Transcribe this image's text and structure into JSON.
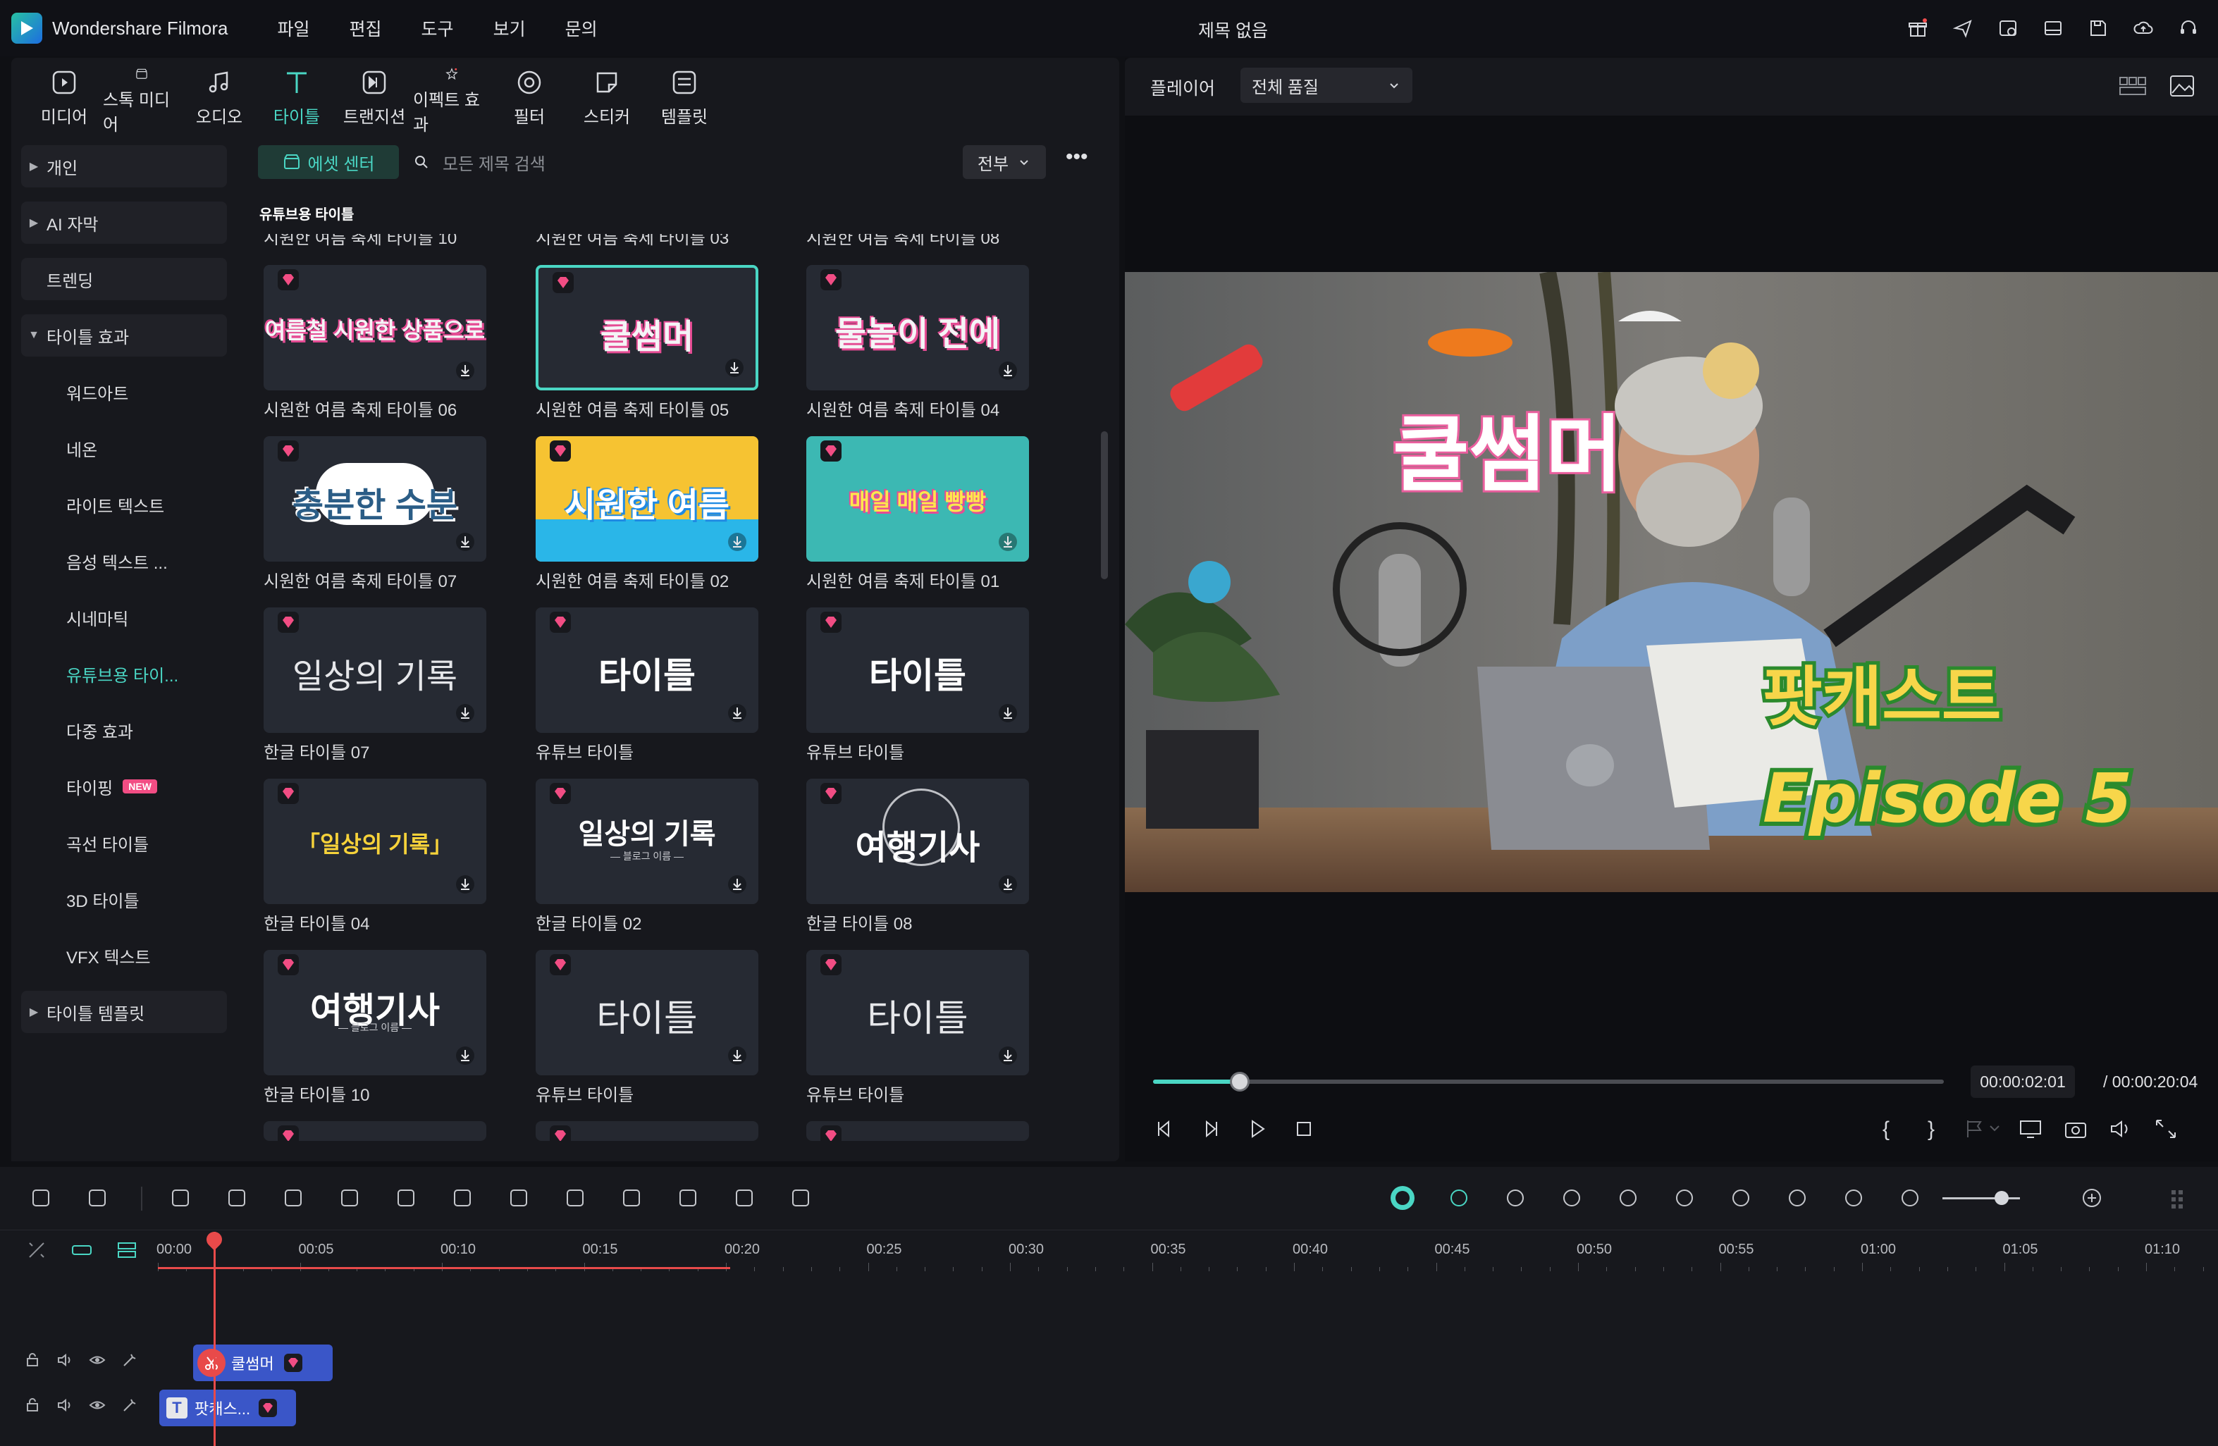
{
  "app": {
    "name": "Wondershare Filmora",
    "document_title": "제목 없음",
    "accent": "#4ad6c4"
  },
  "menu": [
    "파일",
    "편집",
    "도구",
    "보기",
    "문의"
  ],
  "titlebar_icons": [
    "gift-icon",
    "send-icon",
    "task-icon",
    "layout-icon",
    "save-icon",
    "cloud-icon",
    "support-icon"
  ],
  "toolbar": [
    {
      "label": "미디어",
      "icon": "media-icon"
    },
    {
      "label": "스톡 미디어",
      "icon": "stock-icon"
    },
    {
      "label": "오디오",
      "icon": "audio-icon"
    },
    {
      "label": "타이틀",
      "icon": "title-icon",
      "active": true
    },
    {
      "label": "트랜지션",
      "icon": "transition-icon"
    },
    {
      "label": "이펙트 효과",
      "icon": "effect-icon"
    },
    {
      "label": "필터",
      "icon": "filter-icon"
    },
    {
      "label": "스티커",
      "icon": "sticker-icon"
    },
    {
      "label": "템플릿",
      "icon": "template-icon"
    }
  ],
  "sidebar": [
    {
      "label": "개인",
      "type": "group"
    },
    {
      "label": "AI 자막",
      "type": "group"
    },
    {
      "label": "트렌딩",
      "type": "flat"
    },
    {
      "label": "타이틀 효과",
      "type": "open"
    },
    {
      "label": "워드아트",
      "type": "sub"
    },
    {
      "label": "네온",
      "type": "sub"
    },
    {
      "label": "라이트 텍스트",
      "type": "sub"
    },
    {
      "label": "음성 텍스트 ...",
      "type": "sub"
    },
    {
      "label": "시네마틱",
      "type": "sub"
    },
    {
      "label": "유튜브용 타이...",
      "type": "sub",
      "selected": true
    },
    {
      "label": "다중 효과",
      "type": "sub"
    },
    {
      "label": "타이핑",
      "type": "sub",
      "badge": "NEW"
    },
    {
      "label": "곡선 타이틀",
      "type": "sub"
    },
    {
      "label": "3D 타이틀",
      "type": "sub"
    },
    {
      "label": "VFX 텍스트",
      "type": "sub"
    },
    {
      "label": "타이틀 템플릿",
      "type": "group"
    }
  ],
  "grid": {
    "asset_center": "에셋 센터",
    "search_placeholder": "모든 제목 검색",
    "filter": "전부",
    "section": "유튜브용 타이틀",
    "top_labels": [
      "시원한 여름 축제 타이틀 10",
      "시원한 여름 축제 타이틀 03",
      "시원한 여름 축제 타이틀 08"
    ],
    "cards": [
      {
        "label": "시원한 여름 축제 타이틀 06",
        "text": "여름철 시원한 상품으로",
        "theme": "dark-pink"
      },
      {
        "label": "시원한 여름 축제 타이틀 05",
        "text": "쿨썸머",
        "theme": "dark-pink",
        "selected": true
      },
      {
        "label": "시원한 여름 축제 타이틀 04",
        "text": "물놀이 전에",
        "theme": "dark-pink"
      },
      {
        "label": "시원한 여름 축제 타이틀 07",
        "text": "충분한 수분",
        "theme": "cloud"
      },
      {
        "label": "시원한 여름 축제 타이틀 02",
        "text": "시원한 여름",
        "theme": "yellow"
      },
      {
        "label": "시원한 여름 축제 타이틀 01",
        "text": "매일 매일 빵빵",
        "theme": "green"
      },
      {
        "label": "한글 타이틀 07",
        "text": "일상의 기록",
        "theme": "handwrite"
      },
      {
        "label": "유튜브 타이틀",
        "text": "타이틀",
        "theme": "plain"
      },
      {
        "label": "유튜브 타이틀",
        "text": "타이틀",
        "theme": "plain-bold"
      },
      {
        "label": "한글 타이틀 04",
        "text": "「일상의 기록」",
        "theme": "yellow-text"
      },
      {
        "label": "한글 타이틀 02",
        "text": "일상의 기록",
        "sub": "— 블로그 이름 —",
        "theme": "plain"
      },
      {
        "label": "한글 타이틀 08",
        "text": "여행기사",
        "theme": "ring"
      },
      {
        "label": "한글 타이틀 10",
        "text": "여행기사",
        "sub": "— 블로그 이름 —",
        "theme": "plain-bold"
      },
      {
        "label": "유튜브 타이틀",
        "text": "타이틀",
        "theme": "light"
      },
      {
        "label": "유튜브 타이틀",
        "text": "타이틀",
        "theme": "light"
      }
    ]
  },
  "player": {
    "label": "플레이어",
    "quality": "전체 품질",
    "overlay_title": "쿨썸머",
    "overlay_sub1": "팟캐스트",
    "overlay_sub2": "Episode 5",
    "current_time": "00:00:02:01",
    "total_time": "/ 00:00:20:04",
    "progress": 0.11
  },
  "timeline": {
    "ticks": [
      "00:00",
      "00:05",
      "00:10",
      "00:15",
      "00:20",
      "00:25",
      "00:30",
      "00:35",
      "00:40",
      "00:45",
      "00:50",
      "00:55",
      "01:00",
      "01:05",
      "01:10"
    ],
    "clips": [
      {
        "label": "쿨썸머",
        "color": "#3a56c8"
      },
      {
        "label": "팟캐스...",
        "color": "#3a56c8"
      }
    ]
  }
}
